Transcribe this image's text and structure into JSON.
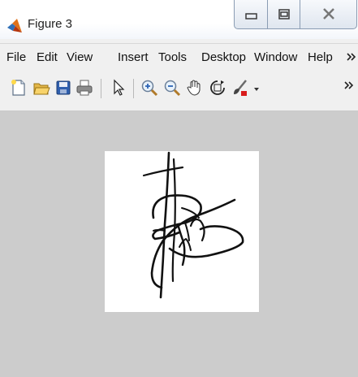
{
  "window": {
    "title": "Figure 3",
    "icon": "matlab-icon",
    "controls": [
      "minimize-icon",
      "maximize-icon",
      "close-icon"
    ]
  },
  "menubar": {
    "items": [
      {
        "label": "File"
      },
      {
        "label": "Edit"
      },
      {
        "label": "View"
      },
      {
        "label": "Insert"
      },
      {
        "label": "Tools"
      },
      {
        "label": "Desktop"
      },
      {
        "label": "Window"
      },
      {
        "label": "Help"
      }
    ],
    "overflow_icon": "chevron-double-right-icon"
  },
  "toolbar": {
    "tools": [
      {
        "name": "new-figure-icon"
      },
      {
        "name": "open-file-icon"
      },
      {
        "name": "save-figure-icon"
      },
      {
        "name": "print-figure-icon"
      },
      {
        "name": "edit-plot-arrow-icon"
      },
      {
        "name": "zoom-in-icon"
      },
      {
        "name": "zoom-out-icon"
      },
      {
        "name": "pan-hand-icon"
      },
      {
        "name": "rotate-3d-icon"
      },
      {
        "name": "data-cursor-brush-icon"
      }
    ],
    "overflow_icon": "chevron-double-right-icon"
  },
  "figure": {
    "background_color": "#cccccc",
    "axes_background": "#ffffff",
    "image_content": "handwritten-signature"
  }
}
